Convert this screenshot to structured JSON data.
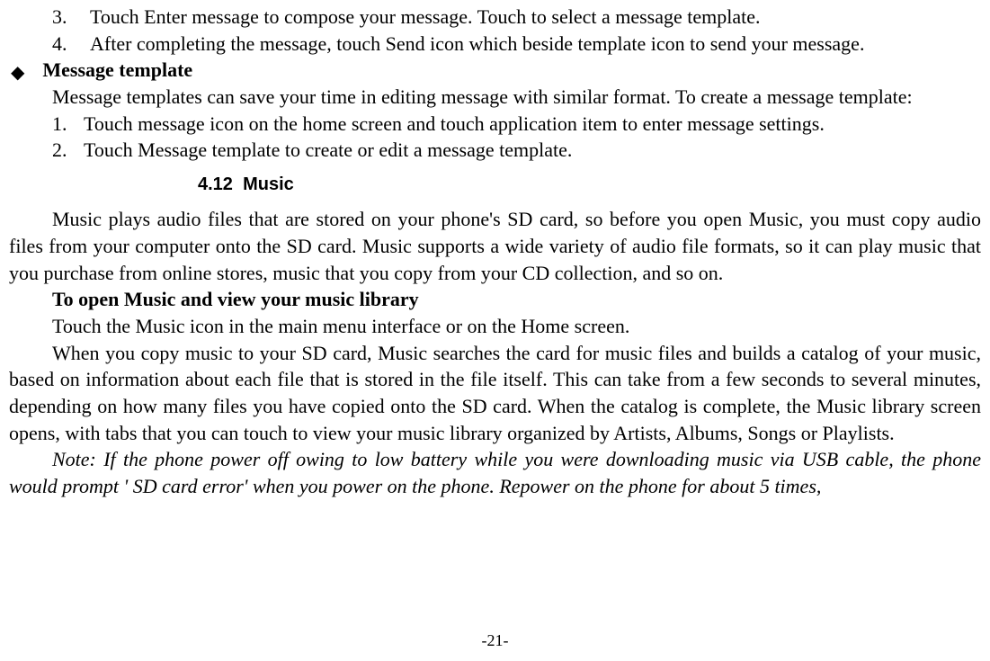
{
  "list1": {
    "item3": {
      "num": "3.",
      "text": "Touch Enter message to compose your message. Touch to select a message template."
    },
    "item4": {
      "num": "4.",
      "text": "After completing the message, touch Send icon which beside template icon to send your message."
    }
  },
  "template_section": {
    "heading": "Message template",
    "para": "Message templates can save your time in editing message with similar format. To create a message template:",
    "item1": {
      "num": "1.",
      "text": "Touch message icon on the home screen and touch application item to enter message settings."
    },
    "item2": {
      "num": "2.",
      "text": "Touch Message template to create or edit a message template."
    }
  },
  "section": {
    "num": "4.12",
    "title": "Music"
  },
  "music": {
    "intro": "Music plays audio files that are stored on your phone's SD card, so before you open Music, you must copy audio files from your computer onto the SD card. Music supports a wide variety of audio file formats, so it can play music that you purchase from online stores, music that you copy from your CD collection, and so on.",
    "sub_heading": "To open Music and view your music library",
    "line1": "Touch the Music icon in the main menu interface or on the Home screen.",
    "para2": "When you copy music to your SD card, Music searches the card for music files and builds a catalog of your music, based on information about each file that is stored in the file itself. This can take from a few seconds to several minutes, depending on how many files you have copied onto the SD card. When the catalog is complete, the Music library screen opens, with tabs that you can touch to view your music library organized by Artists, Albums, Songs or Playlists.",
    "note": "Note: If the phone power off owing to low battery while you were downloading music via USB cable, the phone would prompt ' SD card error' when you power on the phone. Repower on the phone for about 5 times,"
  },
  "footer": "-21-"
}
